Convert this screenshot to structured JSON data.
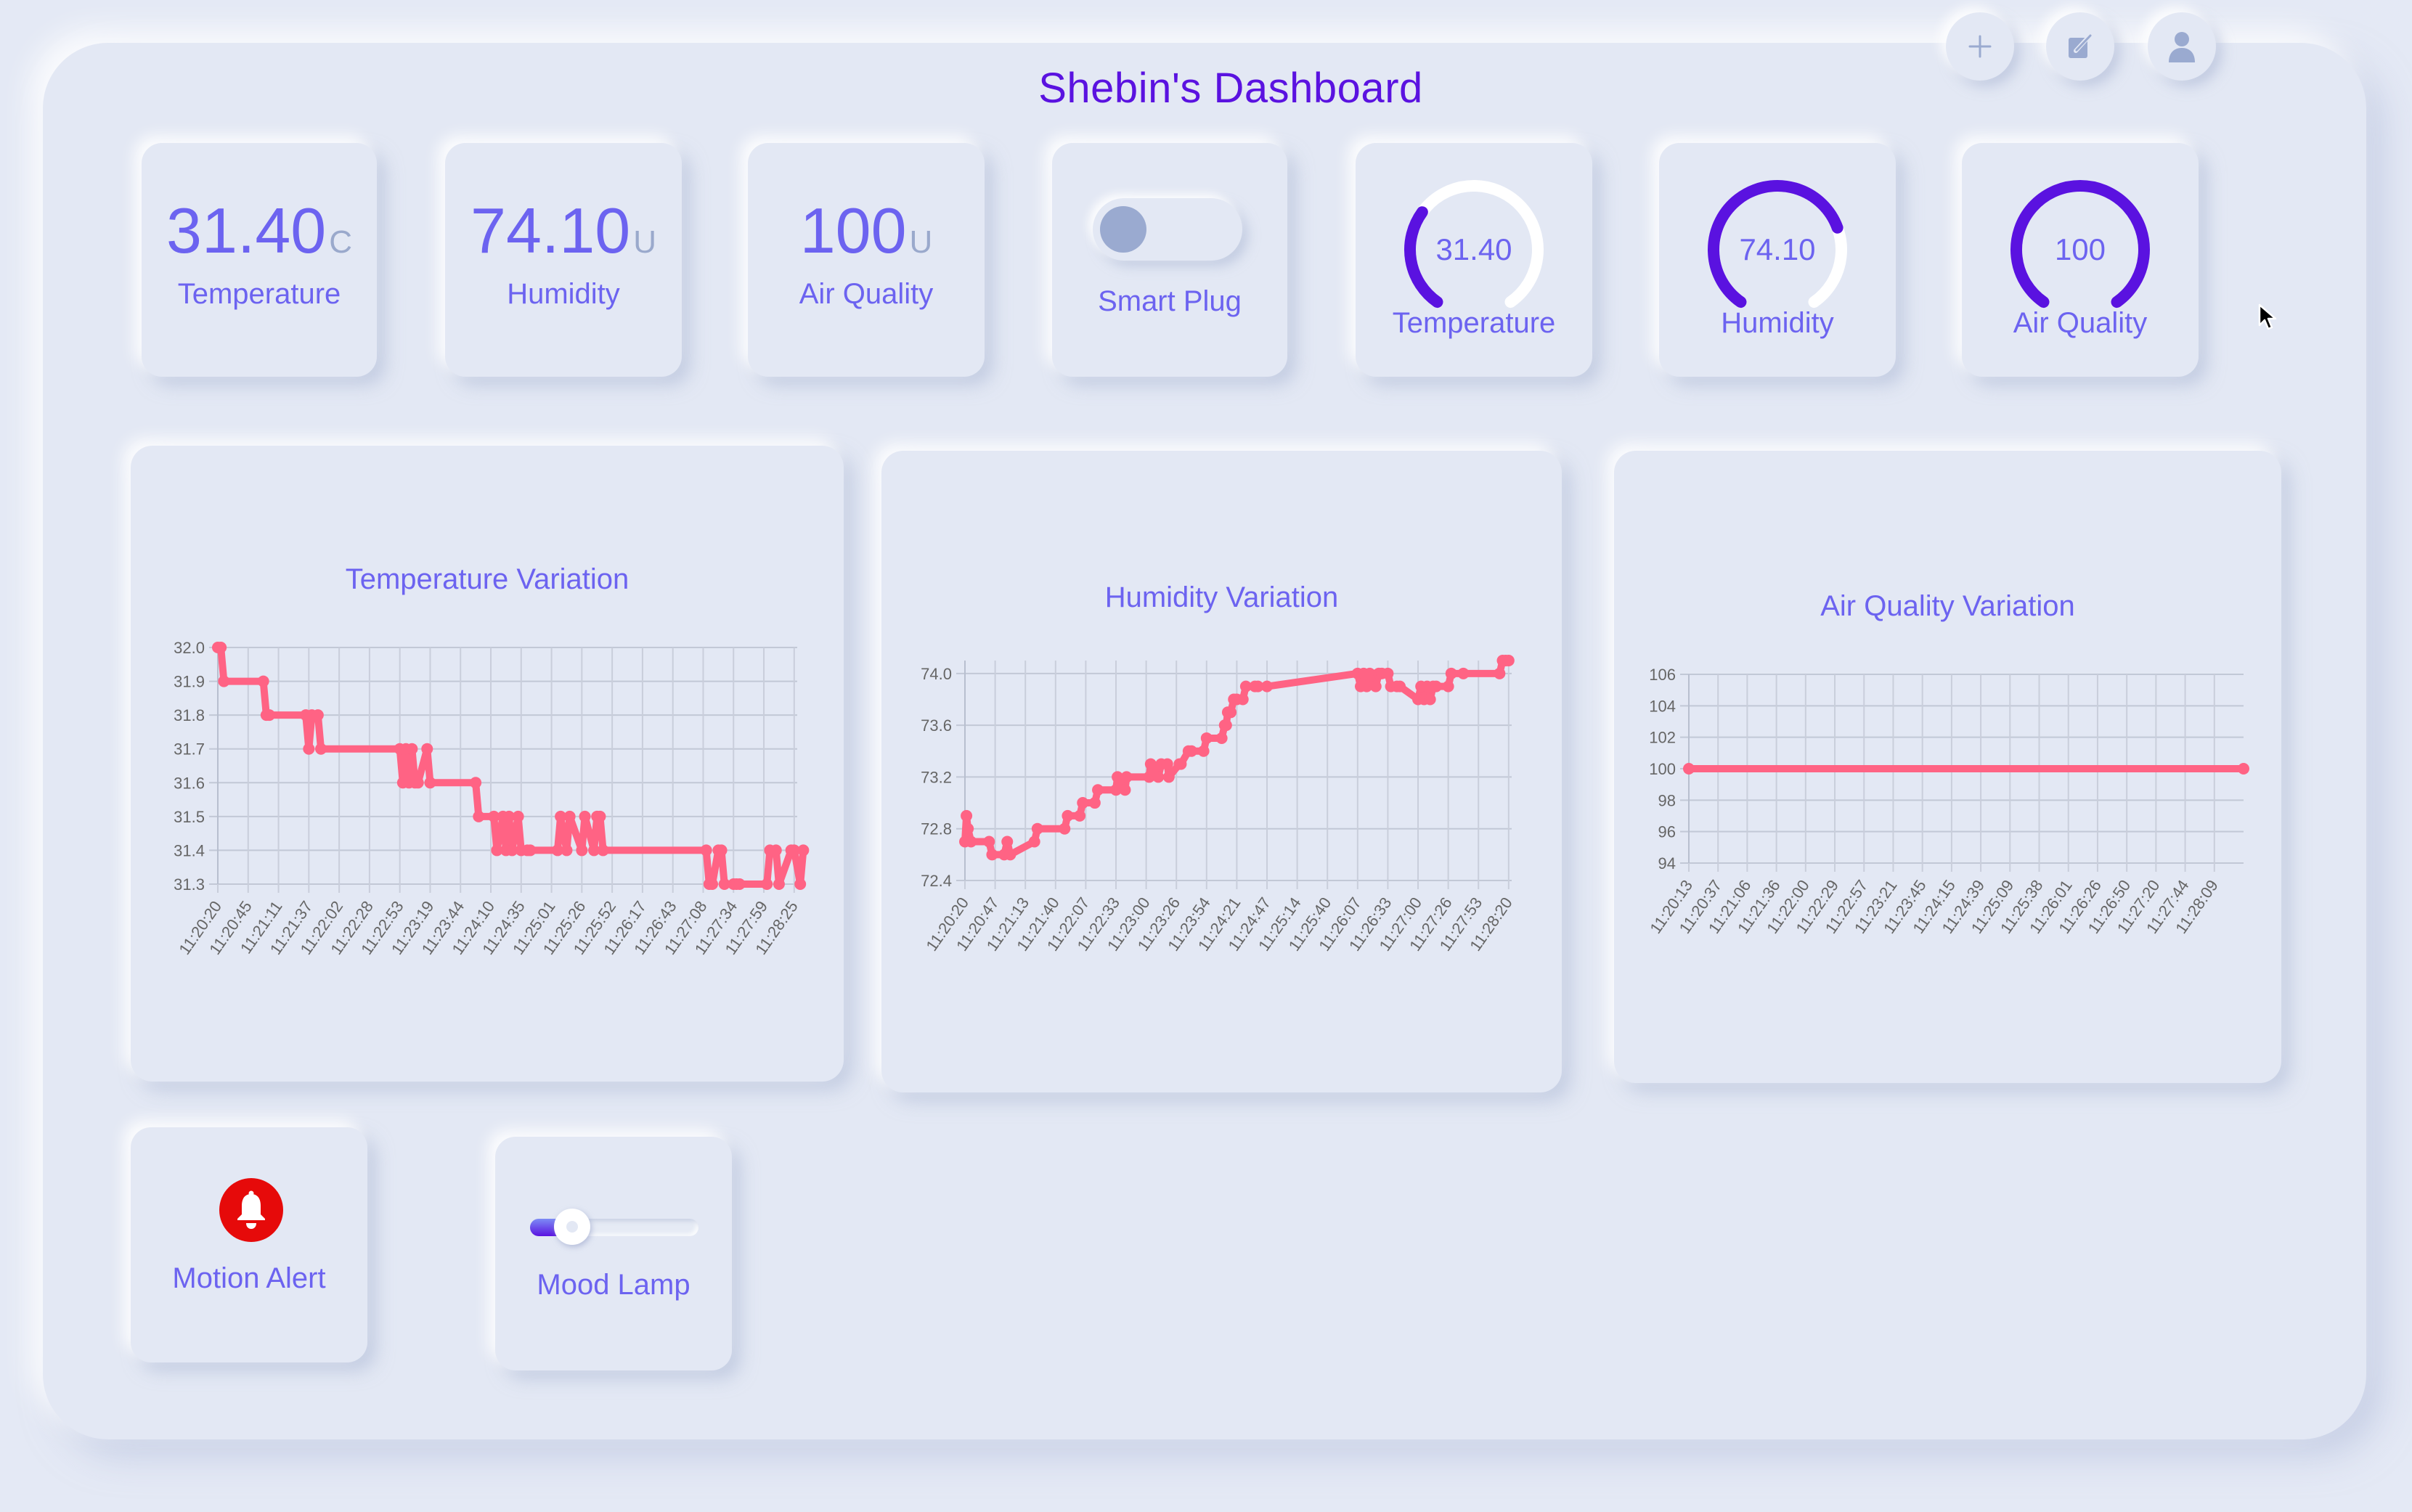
{
  "header": {
    "title": "Shebin's Dashboard",
    "buttons": [
      {
        "name": "add",
        "icon": "plus-icon"
      },
      {
        "name": "edit",
        "icon": "edit-icon"
      },
      {
        "name": "profile",
        "icon": "user-icon"
      }
    ]
  },
  "colors": {
    "accent": "#5a12e0",
    "label": "#6c63f0",
    "unit": "#9aa9cc",
    "line": "#ff6384",
    "gauge_track": "#ffffff",
    "alert": "#e60a0a",
    "background": "#e3e8f4"
  },
  "stats": [
    {
      "value": "31.40",
      "unit": "C",
      "label": "Temperature"
    },
    {
      "value": "74.10",
      "unit": "U",
      "label": "Humidity"
    },
    {
      "value": "100",
      "unit": "U",
      "label": "Air Quality"
    }
  ],
  "smart_plug": {
    "label": "Smart Plug",
    "state": "off"
  },
  "gauges": [
    {
      "value": "31.40",
      "label": "Temperature",
      "fraction": 0.314
    },
    {
      "value": "74.10",
      "label": "Humidity",
      "fraction": 0.741
    },
    {
      "value": "100",
      "label": "Air Quality",
      "fraction": 1.0
    }
  ],
  "motion_alert": {
    "label": "Motion Alert",
    "icon": "bell-icon"
  },
  "mood_lamp": {
    "label": "Mood Lamp",
    "value_percent": 25
  },
  "chart_data": [
    {
      "type": "line",
      "title": "Temperature Variation",
      "xlabel": "",
      "ylabel": "",
      "ylim": [
        31.3,
        32.0
      ],
      "yticks": [
        "32.0",
        "31.9",
        "31.8",
        "31.7",
        "31.6",
        "31.5",
        "31.4",
        "31.3"
      ],
      "grid": true,
      "categories": [
        "11:20:20",
        "11:20:45",
        "11:21:11",
        "11:21:37",
        "11:22:02",
        "11:22:28",
        "11:22:53",
        "11:23:19",
        "11:23:44",
        "11:24:10",
        "11:24:35",
        "11:25:01",
        "11:25:26",
        "11:25:52",
        "11:26:17",
        "11:26:43",
        "11:27:08",
        "11:27:34",
        "11:27:59",
        "11:28:25"
      ],
      "series": [
        {
          "name": "Temperature",
          "color": "#ff6384",
          "x": [
            0,
            0.1,
            0.2,
            1.5,
            1.6,
            1.7,
            2.9,
            3.0,
            3.1,
            3.3,
            3.4,
            6.0,
            6.1,
            6.2,
            6.3,
            6.4,
            6.5,
            6.6,
            6.9,
            7.0,
            8.5,
            8.6,
            9.1,
            9.2,
            9.4,
            9.5,
            9.6,
            9.7,
            9.9,
            10.0,
            10.2,
            10.3,
            11.2,
            11.3,
            11.5,
            11.6,
            12.0,
            12.1,
            12.4,
            12.5,
            12.6,
            12.7,
            16.1,
            16.2,
            16.3,
            16.5,
            16.6,
            16.7,
            17.0,
            17.1,
            17.2,
            18.1,
            18.2,
            18.4,
            18.5,
            18.9,
            19.0,
            19.2,
            19.3
          ],
          "y": [
            32.0,
            32.0,
            31.9,
            31.9,
            31.8,
            31.8,
            31.8,
            31.7,
            31.8,
            31.8,
            31.7,
            31.7,
            31.6,
            31.7,
            31.6,
            31.7,
            31.6,
            31.6,
            31.7,
            31.6,
            31.6,
            31.5,
            31.5,
            31.4,
            31.5,
            31.4,
            31.5,
            31.4,
            31.5,
            31.4,
            31.4,
            31.4,
            31.4,
            31.5,
            31.4,
            31.5,
            31.4,
            31.5,
            31.4,
            31.5,
            31.5,
            31.4,
            31.4,
            31.3,
            31.3,
            31.4,
            31.4,
            31.3,
            31.3,
            31.3,
            31.3,
            31.3,
            31.4,
            31.4,
            31.3,
            31.4,
            31.4,
            31.3,
            31.4
          ]
        }
      ]
    },
    {
      "type": "line",
      "title": "Humidity Variation",
      "xlabel": "",
      "ylabel": "",
      "ylim": [
        72.4,
        74.1
      ],
      "yticks": [
        "74.0",
        "73.6",
        "73.2",
        "72.8",
        "72.4"
      ],
      "grid": true,
      "categories": [
        "11:20:20",
        "11:20:47",
        "11:21:13",
        "11:21:40",
        "11:22:07",
        "11:22:33",
        "11:23:00",
        "11:23:26",
        "11:23:54",
        "11:24:21",
        "11:24:47",
        "11:25:14",
        "11:25:40",
        "11:26:07",
        "11:26:33",
        "11:27:00",
        "11:27:26",
        "11:27:53",
        "11:28:20"
      ],
      "series": [
        {
          "name": "Humidity",
          "color": "#ff6384",
          "x": [
            0,
            0.05,
            0.1,
            0.2,
            0.8,
            0.9,
            1.3,
            1.4,
            1.5,
            2.3,
            2.4,
            3.3,
            3.4,
            3.8,
            3.9,
            4.3,
            4.4,
            5.0,
            5.05,
            5.3,
            5.35,
            6.1,
            6.15,
            6.4,
            6.5,
            6.7,
            6.75,
            7.1,
            7.15,
            7.4,
            7.5,
            7.9,
            8.0,
            8.5,
            8.6,
            8.65,
            8.7,
            8.8,
            8.9,
            9.0,
            9.2,
            9.3,
            9.6,
            9.7,
            10.0,
            13.0,
            13.1,
            13.2,
            13.3,
            13.4,
            13.6,
            13.7,
            13.8,
            14.0,
            14.1,
            14.3,
            14.4,
            15.0,
            15.1,
            15.2,
            15.3,
            15.4,
            15.5,
            15.6,
            16.0,
            16.1,
            16.5,
            17.7,
            17.8,
            17.9,
            18.0
          ],
          "y": [
            72.7,
            72.9,
            72.8,
            72.7,
            72.7,
            72.6,
            72.6,
            72.7,
            72.6,
            72.7,
            72.8,
            72.8,
            72.9,
            72.9,
            73.0,
            73.0,
            73.1,
            73.1,
            73.2,
            73.1,
            73.2,
            73.2,
            73.3,
            73.2,
            73.3,
            73.3,
            73.2,
            73.3,
            73.3,
            73.4,
            73.4,
            73.4,
            73.5,
            73.5,
            73.6,
            73.6,
            73.7,
            73.7,
            73.8,
            73.8,
            73.8,
            73.9,
            73.9,
            73.9,
            73.9,
            74.0,
            73.9,
            74.0,
            73.9,
            74.0,
            73.9,
            74.0,
            74.0,
            74.0,
            73.9,
            73.9,
            73.9,
            73.8,
            73.9,
            73.8,
            73.9,
            73.8,
            73.9,
            73.9,
            73.9,
            74.0,
            74.0,
            74.0,
            74.1,
            74.1,
            74.1
          ]
        }
      ]
    },
    {
      "type": "line",
      "title": "Air Quality Variation",
      "xlabel": "",
      "ylabel": "",
      "ylim": [
        94,
        106
      ],
      "yticks": [
        "106",
        "104",
        "102",
        "100",
        "98",
        "96",
        "94"
      ],
      "grid": true,
      "categories": [
        "11:20:13",
        "11:20:37",
        "11:21:06",
        "11:21:36",
        "11:22:00",
        "11:22:29",
        "11:22:57",
        "11:23:21",
        "11:23:45",
        "11:24:15",
        "11:24:39",
        "11:25:09",
        "11:25:38",
        "11:26:01",
        "11:26:26",
        "11:26:50",
        "11:27:20",
        "11:27:44",
        "11:28:09"
      ],
      "series": [
        {
          "name": "Air Quality",
          "color": "#ff6384",
          "x": [
            0,
            19
          ],
          "y": [
            100,
            100
          ]
        }
      ]
    }
  ]
}
